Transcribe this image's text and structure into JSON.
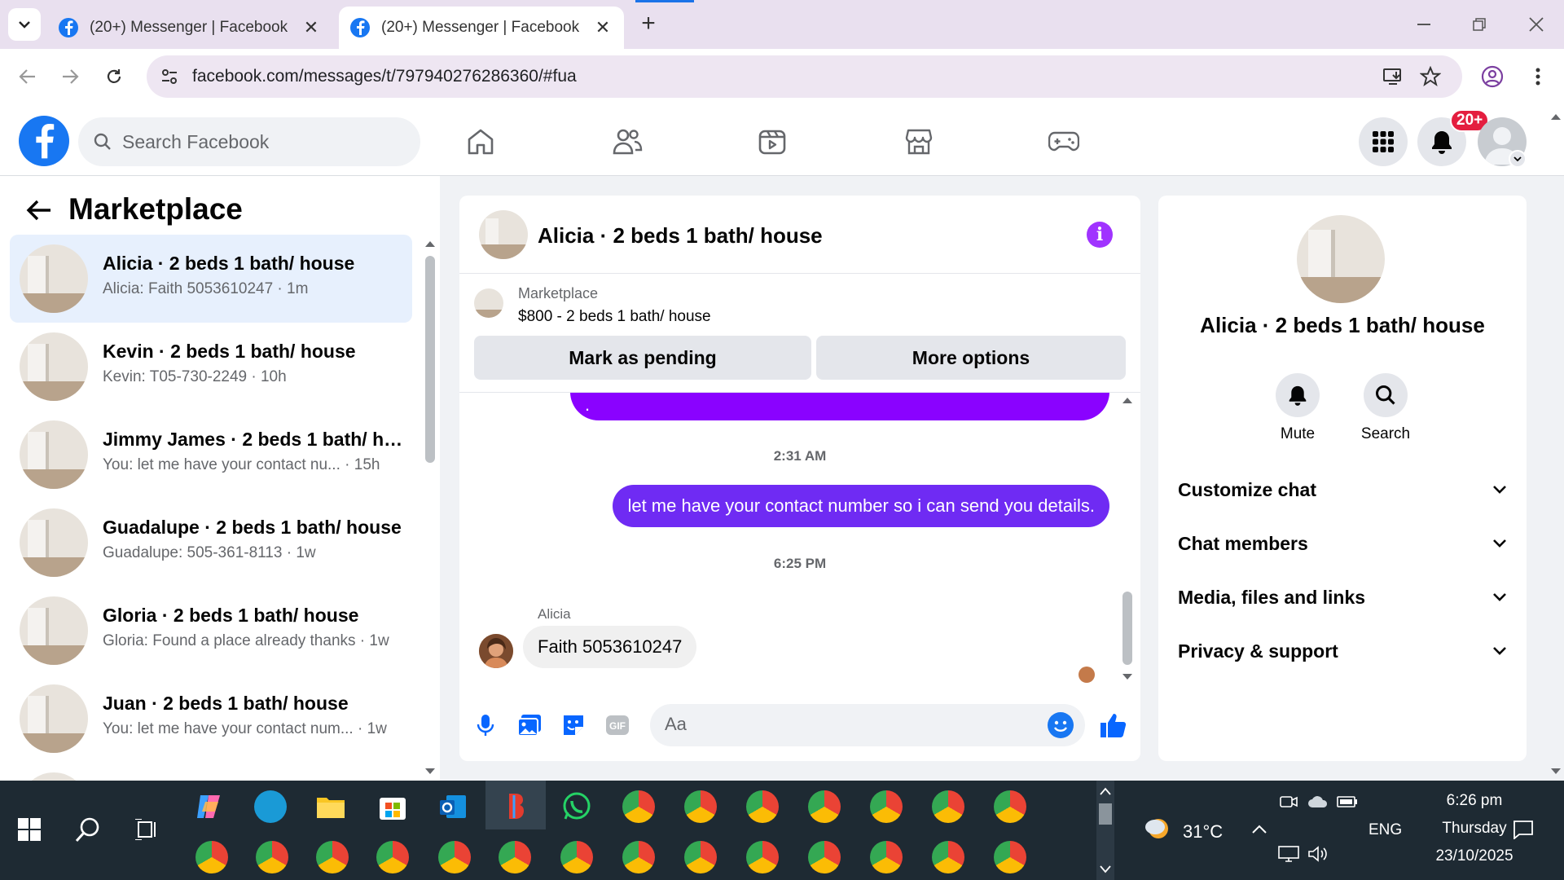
{
  "browser": {
    "tabs": [
      {
        "title": "(20+) Messenger | Facebook",
        "active": false
      },
      {
        "title": "(20+) Messenger | Facebook",
        "active": true
      }
    ],
    "url": "facebook.com/messages/t/797940276286360/#fua",
    "icons": [
      "tab-list-icon",
      "facebook-favicon",
      "close-icon",
      "plus-icon",
      "minimize-icon",
      "restore-icon",
      "window-close-icon",
      "back-arrow-icon",
      "forward-arrow-icon",
      "reload-icon",
      "site-settings-icon",
      "install-app-icon",
      "bookmark-star-icon",
      "profile-icon",
      "kebab-menu-icon"
    ]
  },
  "fb_header": {
    "search_placeholder": "Search Facebook",
    "notification_badge": "20+",
    "nav_icons": [
      "home-icon",
      "friends-icon",
      "video-icon",
      "marketplace-icon",
      "gaming-icon"
    ],
    "right_icons": [
      "menu-grid-icon",
      "bell-icon",
      "account-avatar"
    ],
    "accent": "#1877f2"
  },
  "left_panel": {
    "title": "Marketplace",
    "conversations": [
      {
        "title": "Alicia · 2 beds 1 bath/ house",
        "subtitle": "Alicia: Faith 5053610247 · 1m",
        "selected": true
      },
      {
        "title": "Kevin · 2 beds 1 bath/ house",
        "subtitle": "Kevin: T05-730-2249 · 10h",
        "selected": false
      },
      {
        "title": "Jimmy James · 2 beds 1 bath/ ho...",
        "subtitle": "You: let me have your contact nu...  · 15h",
        "selected": false
      },
      {
        "title": "Guadalupe · 2 beds 1 bath/ house",
        "subtitle": "Guadalupe: 505-361-8113 · 1w",
        "selected": false
      },
      {
        "title": "Gloria · 2 beds 1 bath/ house",
        "subtitle": "Gloria: Found a place already thanks · 1w",
        "selected": false
      },
      {
        "title": "Juan · 2 beds 1 bath/ house",
        "subtitle": "You: let me have your contact num... · 1w",
        "selected": false
      }
    ]
  },
  "chat": {
    "title": "Alicia · 2 beds 1 bath/ house",
    "marketplace_label": "Marketplace",
    "listing": "$800 - 2 beds 1 bath/ house",
    "mark_pending": "Mark as pending",
    "more_options": "More options",
    "top_bubble_text": ".",
    "timestamp1": "2:31 AM",
    "outgoing_message": "let me have your contact number so i can send you details.",
    "timestamp2": "6:25 PM",
    "sender_name": "Alicia",
    "incoming_message": "Faith 5053610247",
    "composer_placeholder": "Aa",
    "outgoing_color": "#6f2bf3",
    "composer_icons": [
      "microphone-icon",
      "photo-icon",
      "sticker-icon",
      "gif-icon",
      "emoji-icon",
      "thumbs-up-icon"
    ]
  },
  "info_panel": {
    "name": "Alicia · 2 beds 1 bath/ house",
    "mute": "Mute",
    "search": "Search",
    "sections": [
      "Customize chat",
      "Chat members",
      "Media, files and links",
      "Privacy & support"
    ]
  },
  "taskbar": {
    "temperature": "31°C",
    "language": "ENG",
    "time": "6:26 pm",
    "day": "Thursday",
    "date": "23/10/2025"
  }
}
